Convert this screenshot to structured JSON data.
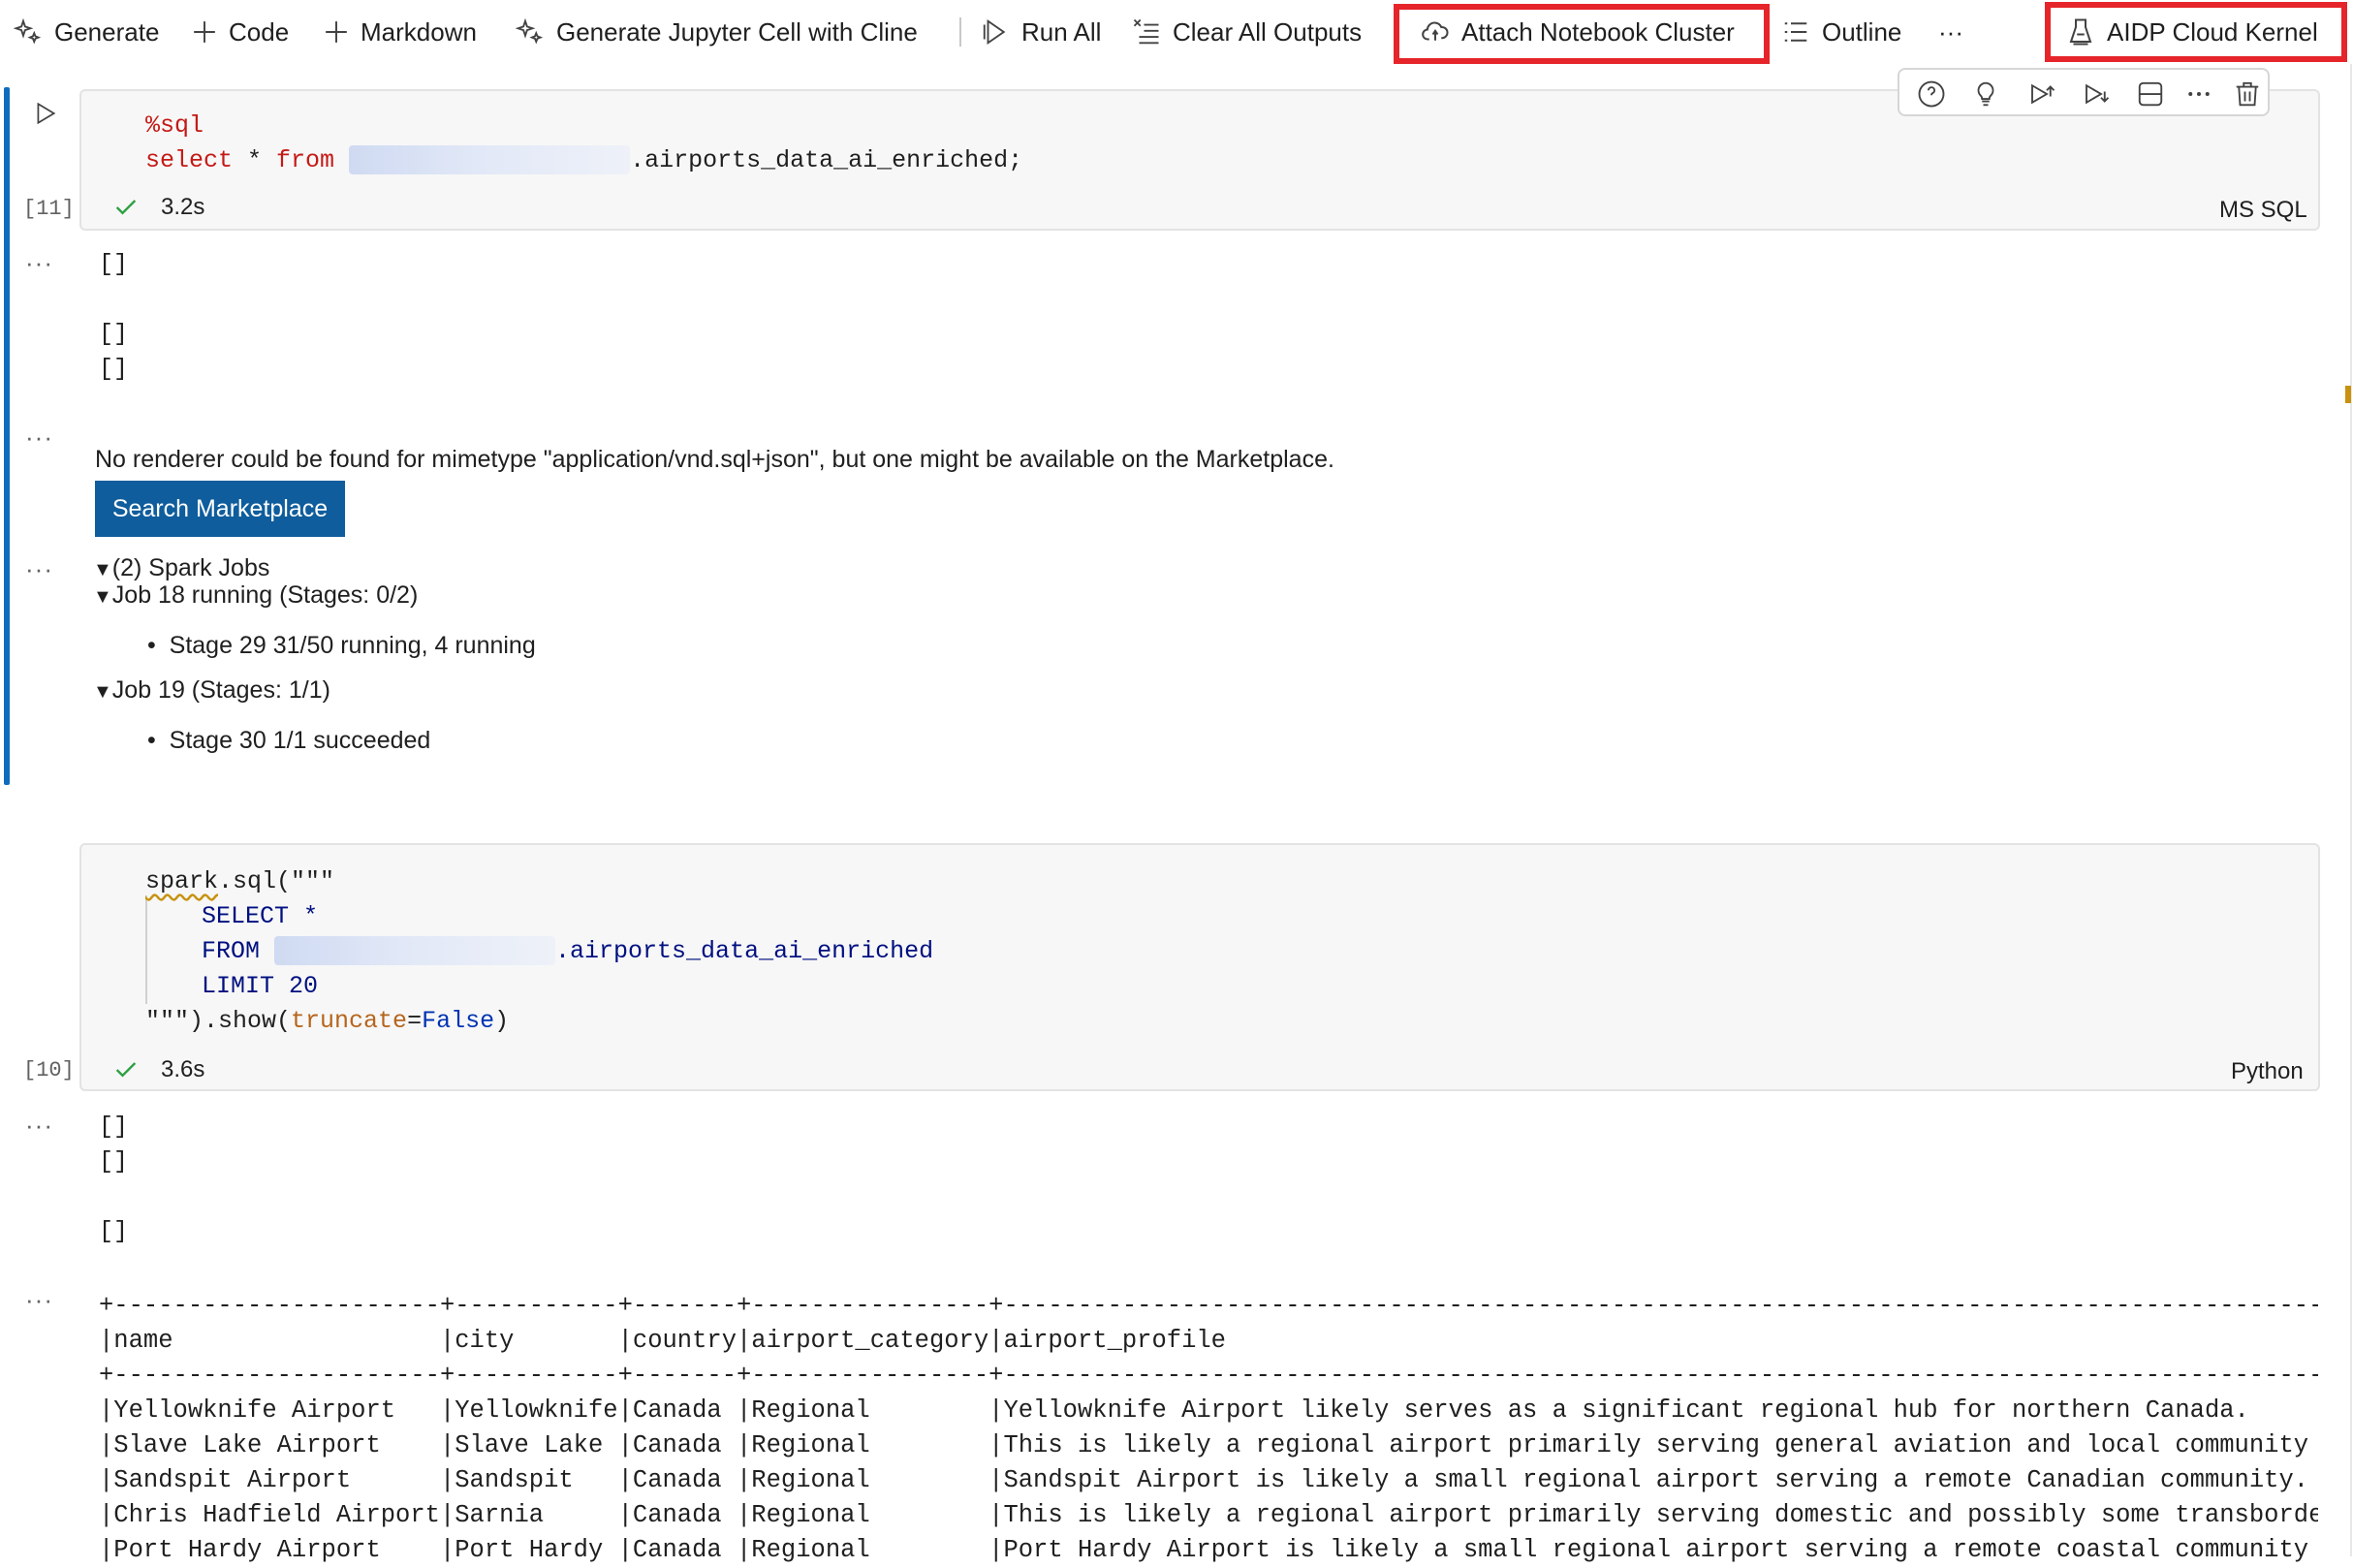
{
  "toolbar": {
    "generate": "Generate",
    "code": "Code",
    "markdown": "Markdown",
    "generate_cline": "Generate Jupyter Cell with Cline",
    "run_all": "Run All",
    "clear_outputs": "Clear All Outputs",
    "attach_cluster": "Attach Notebook Cluster",
    "outline": "Outline",
    "more": "···",
    "kernel": "AIDP Cloud Kernel"
  },
  "cell1": {
    "magic": "%sql",
    "kw_select": "select",
    "star": " * ",
    "kw_from": "from",
    "table": ".airports_data_ai_enriched;",
    "exec_count": "[11]",
    "duration": "3.2s",
    "language": "MS SQL"
  },
  "output1": {
    "dots": "···",
    "line1": "[]",
    "line2": "[]",
    "line3": "[]",
    "renderer_msg": "No renderer could be found for mimetype \"application/vnd.sql+json\", but one might be available on the Marketplace.",
    "search_button": "Search Marketplace",
    "spark_jobs": "(2) Spark Jobs",
    "job18": "Job 18 running (Stages: 0/2)",
    "stage29": "Stage 29 31/50 running, 4 running",
    "job19": "Job 19 (Stages: 1/1)",
    "stage30": "Stage 30 1/1 succeeded"
  },
  "cell2": {
    "line1_fn": "spark",
    "line1_rest": ".sql(\"\"\"",
    "line2": "SELECT *",
    "line3_kw": "FROM",
    "line3_table": ".airports_data_ai_enriched",
    "line4": "LIMIT 20",
    "line5_a": "\"\"\").show(",
    "line5_param": "truncate",
    "line5_eq": "=",
    "line5_val": "False",
    "line5_close": ")",
    "exec_count": "[10]",
    "duration": "3.6s",
    "language": "Python"
  },
  "output2": {
    "line1": "[]",
    "line2": "[]",
    "line3": "[]",
    "table_text": "+----------------------+-----------+-------+----------------+------------------------------------------------------------------------------------------------------------------------------------------------------------------------------------\n|name                  |city       |country|airport_category|airport_profile\n+----------------------+-----------+-------+----------------+------------------------------------------------------------------------------------------------------------------------------------------------------------------------------------\n|Yellowknife Airport   |Yellowknife|Canada |Regional        |Yellowknife Airport likely serves as a significant regional hub for northern Canada.\n|Slave Lake Airport    |Slave Lake |Canada |Regional        |This is likely a regional airport primarily serving general aviation and local community needs.\n|Sandspit Airport      |Sandspit   |Canada |Regional        |Sandspit Airport is likely a small regional airport serving a remote Canadian community.\n|Chris Hadfield Airport|Sarnia     |Canada |Regional        |This is likely a regional airport primarily serving domestic and possibly some transborder routes\n|Port Hardy Airport    |Port Hardy |Canada |Regional        |Port Hardy Airport is likely a small regional airport serving a remote coastal community on Vancouver"
  }
}
